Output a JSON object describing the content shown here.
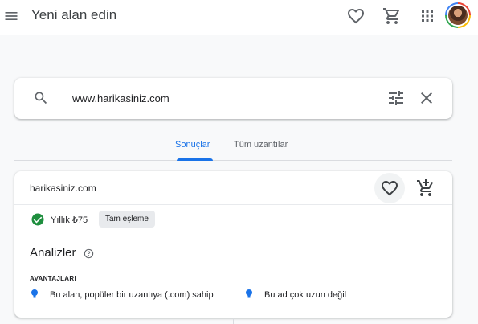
{
  "header": {
    "title": "Yeni alan edin",
    "icons": [
      "menu-icon",
      "heart-icon",
      "cart-icon",
      "apps-grid-icon"
    ],
    "avatar": "user-avatar"
  },
  "search": {
    "value": "www.harikasiniz.com",
    "placeholder": "",
    "icons": [
      "search-icon",
      "tune-icon",
      "close-icon"
    ]
  },
  "tabs": [
    {
      "label": "Sonuçlar",
      "active": true
    },
    {
      "label": "Tüm uzantılar",
      "active": false
    }
  ],
  "result": {
    "domain": "harikasiniz.com",
    "price": "Yıllık ₺75",
    "badge": "Tam eşleme",
    "section_title": "Analizler",
    "advantages_label": "AVANTAJLARI",
    "advantages": [
      "Bu alan, popüler bir uzantıya (.com) sahip",
      "Bu ad çok uzun değil"
    ]
  },
  "colors": {
    "accent": "#1a73e8",
    "success": "#1e8e3e",
    "text": "#202124",
    "muted": "#5f6368",
    "background": "#f8f9fa"
  }
}
